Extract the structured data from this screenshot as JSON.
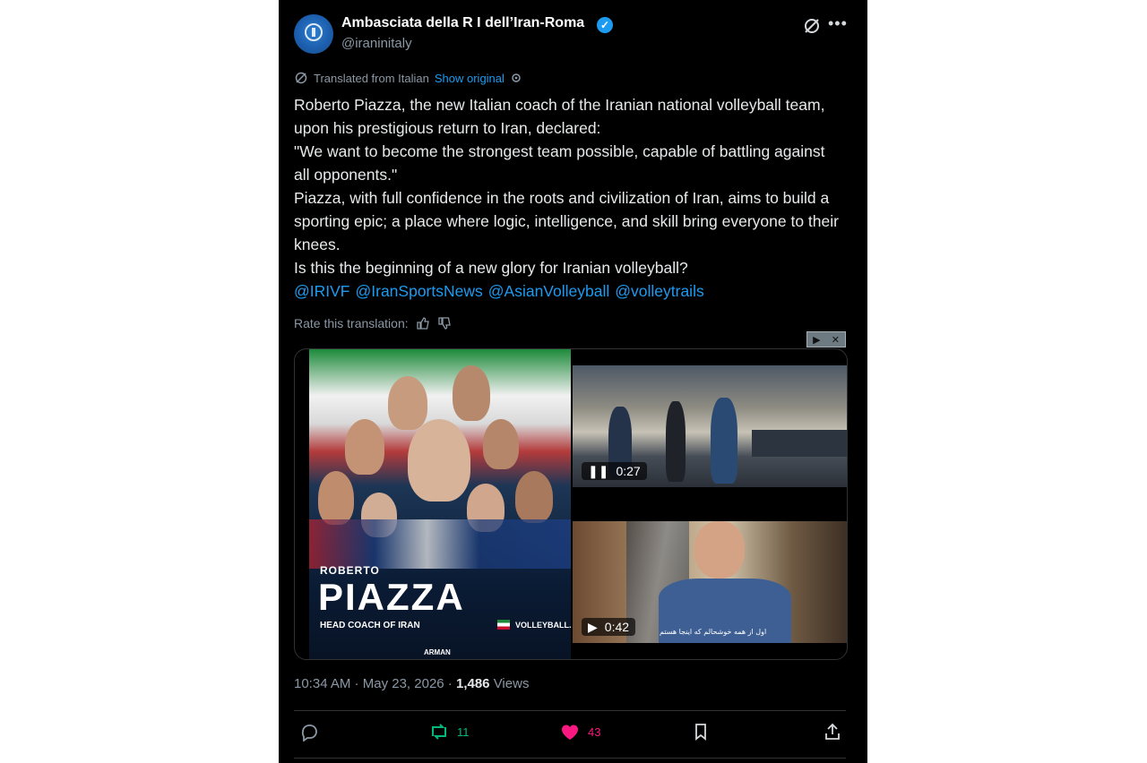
{
  "post": {
    "author_name": "Ambasciata della R I dell’Iran-Roma",
    "handle": "@iraninitaly",
    "translated_label": "Translated from Italian",
    "show_original": "Show original",
    "body_lines": [
      "Roberto Piazza, the new Italian coach of the Iranian national volleyball team, upon his prestigious return to Iran, declared:",
      "\"We want to become the strongest team possible, capable of battling against all opponents.\"",
      "Piazza, with full confidence in the roots and civilization of Iran, aims to build a sporting epic; a place where logic, intelligence, and skill bring everyone to their knees.",
      "Is this the beginning of a new glory for Iranian volleyball?"
    ],
    "mentions": [
      "@IRIVF",
      "@IranSportsNews",
      "@AsianVolleyball",
      "@volleytrails"
    ],
    "rate_label": "Rate this translation:",
    "media": {
      "poster": {
        "first_name": "ROBERTO",
        "last_name": "PIAZZA",
        "subtitle": "HEAD COACH OF IRAN",
        "brand": "VOLLEYBALL.IR",
        "jersey_name": "ARMAN"
      },
      "video1": {
        "time": "0:27",
        "state": "pause-icon"
      },
      "video2": {
        "time": "0:42",
        "state": "play-icon",
        "caption": "اول از همه خوشحالم که اینجا هستم"
      }
    },
    "time": "10:34 AM",
    "date": "May 23, 2026",
    "views_count": "1,486",
    "views_label": "Views",
    "actions": {
      "reply_count": "",
      "repost_count": "11",
      "like_count": "43"
    },
    "colors": {
      "link": "#1d9bf0",
      "repost": "#00ba7c",
      "like": "#f91880",
      "background": "#000000"
    }
  }
}
